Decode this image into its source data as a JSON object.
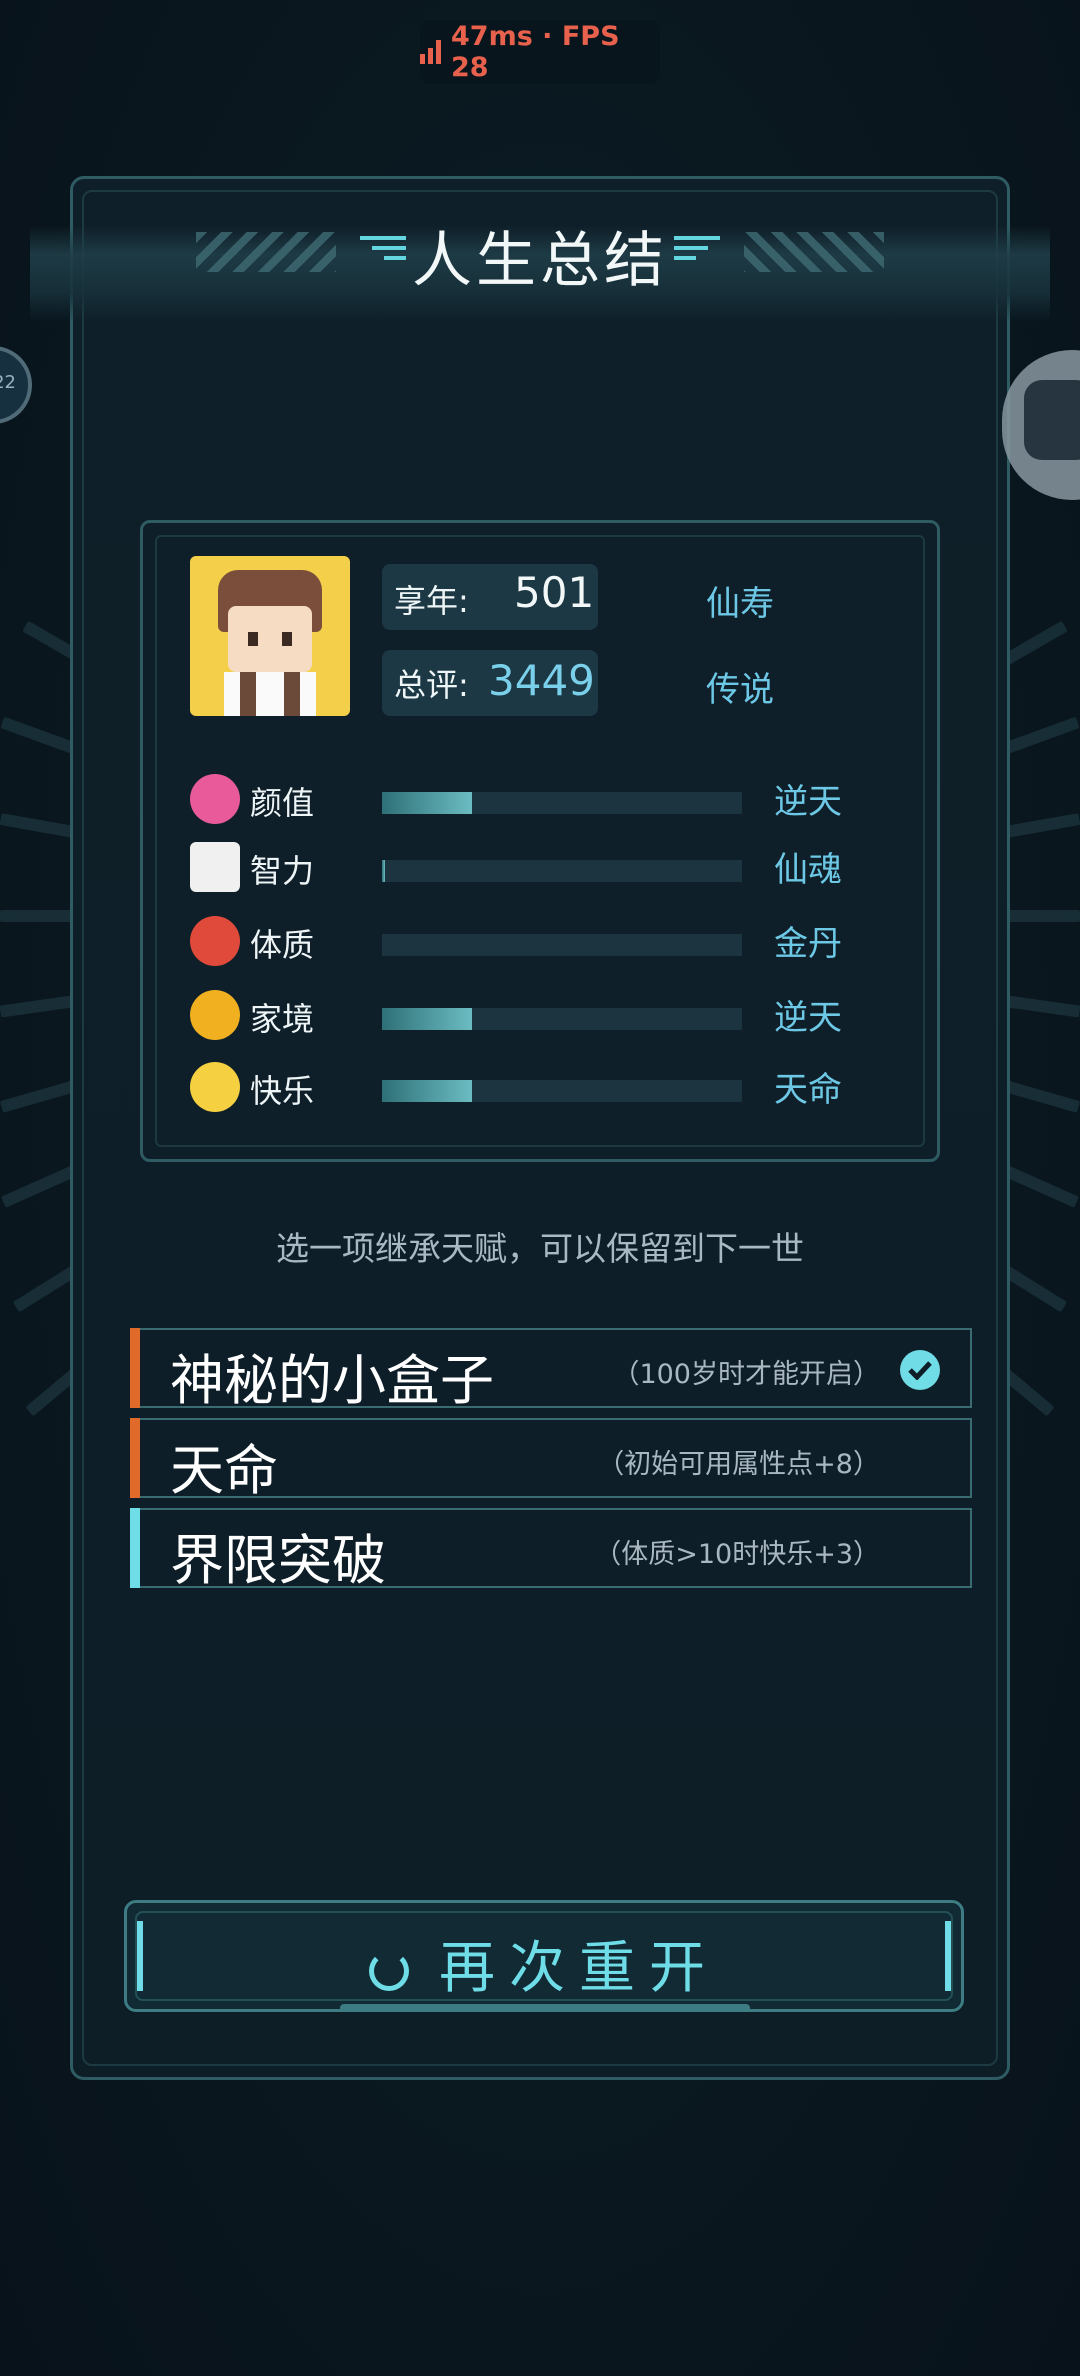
{
  "status": {
    "ping": "47ms · FPS 28"
  },
  "side": {
    "left_badge": "22"
  },
  "title": "人生总结",
  "summary": {
    "age_label": "享年:",
    "age_value": "501",
    "age_grade": "仙寿",
    "score_label": "总评:",
    "score_value": "3449",
    "score_grade": "传说"
  },
  "attributes": [
    {
      "icon": "bow-icon",
      "label": "颜值",
      "fill": 0.25,
      "grade": "逆天"
    },
    {
      "icon": "book-icon",
      "label": "智力",
      "fill": 0.01,
      "grade": "仙魂"
    },
    {
      "icon": "heart-icon",
      "label": "体质",
      "fill": 0.0,
      "grade": "金丹"
    },
    {
      "icon": "coin-icon",
      "label": "家境",
      "fill": 0.25,
      "grade": "逆天"
    },
    {
      "icon": "sunglasses-face-icon",
      "label": "快乐",
      "fill": 0.25,
      "grade": "天命"
    }
  ],
  "hint": "选一项继承天赋，可以保留到下一世",
  "talents": [
    {
      "name": "神秘的小盒子",
      "desc": "（100岁时才能开启）",
      "stripe": "#e06a2a",
      "selected": true
    },
    {
      "name": "天命",
      "desc": "（初始可用属性点+8）",
      "stripe": "#e06a2a",
      "selected": false
    },
    {
      "name": "界限突破",
      "desc": "（体质>10时快乐+3）",
      "stripe": "#6fdde8",
      "selected": false
    }
  ],
  "restart_label": "再次重开",
  "colors": {
    "accent": "#6fdde8",
    "grade": "#6dc8e6",
    "orange": "#e06a2a",
    "status": "#e8614d"
  }
}
